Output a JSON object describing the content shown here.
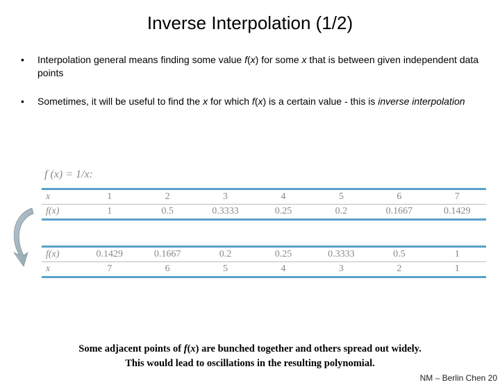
{
  "title": "Inverse Interpolation (1/2)",
  "bullets": [
    {
      "pre": "Interpolation general means finding some value ",
      "fx": "f",
      "mid": "(",
      "x": "x",
      "post1": ") for some ",
      "x2": "x",
      "post2": " that is between given independent data points"
    },
    {
      "pre": "Sometimes, it will be useful to find the ",
      "x": "x",
      "post1": " for which ",
      "fx": "f",
      "mid": "(",
      "x2": "x",
      "post2": ") is a certain value - this is ",
      "em": "inverse interpolation"
    }
  ],
  "func_label": "f (x) = 1/x:",
  "table1": {
    "rowA_label": "x",
    "rowB_label": "f(x)",
    "rowA": [
      "1",
      "2",
      "3",
      "4",
      "5",
      "6",
      "7"
    ],
    "rowB": [
      "1",
      "0.5",
      "0.3333",
      "0.25",
      "0.2",
      "0.1667",
      "0.1429"
    ]
  },
  "table2": {
    "rowA_label": "f(x)",
    "rowB_label": "x",
    "rowA": [
      "0.1429",
      "0.1667",
      "0.2",
      "0.25",
      "0.3333",
      "0.5",
      "1"
    ],
    "rowB": [
      "7",
      "6",
      "5",
      "4",
      "3",
      "2",
      "1"
    ]
  },
  "note1_a": "Some adjacent points of ",
  "note1_fx": "f",
  "note1_b": "(",
  "note1_x": "x",
  "note1_c": ") are bunched together and others spread out widely.",
  "note2": "This would lead to oscillations in the resulting polynomial.",
  "footer": "NM – Berlin Chen 20"
}
